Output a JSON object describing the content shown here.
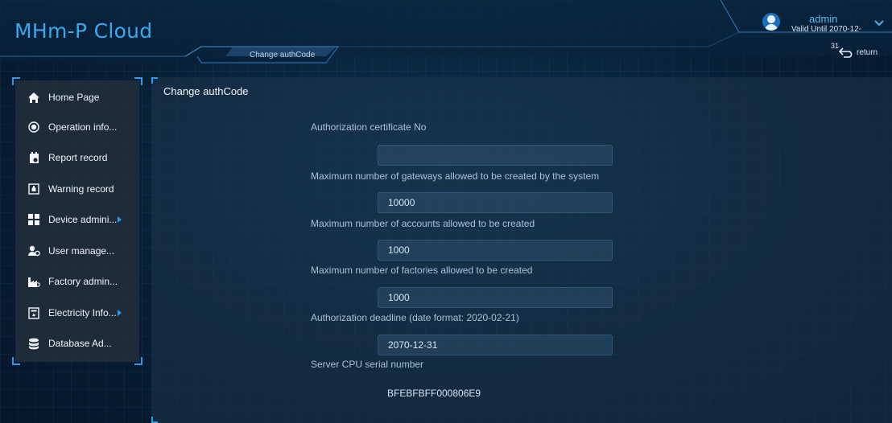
{
  "app": {
    "title": "MHm-P Cloud",
    "page_tab": "Change authCode"
  },
  "user": {
    "name": "admin",
    "valid_until": "Valid Until 2070-12-",
    "date_overflow": "31"
  },
  "header": {
    "return_label": "return"
  },
  "sidebar": {
    "items": [
      {
        "label": "Home Page",
        "icon": "home-icon",
        "has_submenu": false
      },
      {
        "label": "Operation info...",
        "icon": "target-icon",
        "has_submenu": false
      },
      {
        "label": "Report record",
        "icon": "calendar-report-icon",
        "has_submenu": false
      },
      {
        "label": "Warning record",
        "icon": "bell-icon",
        "has_submenu": false
      },
      {
        "label": "Device admini...",
        "icon": "grid-icon",
        "has_submenu": true
      },
      {
        "label": "User manage...",
        "icon": "user-gear-icon",
        "has_submenu": false
      },
      {
        "label": "Factory admin...",
        "icon": "factory-icon",
        "has_submenu": false
      },
      {
        "label": "Electricity Info...",
        "icon": "meter-icon",
        "has_submenu": true
      },
      {
        "label": "Database Ad...",
        "icon": "database-icon",
        "has_submenu": false
      }
    ]
  },
  "main": {
    "title": "Change authCode",
    "fields": [
      {
        "label": "Authorization certificate No",
        "value": ""
      },
      {
        "label": "Maximum number of gateways allowed to be created by the system",
        "value": "10000"
      },
      {
        "label": "Maximum number of accounts allowed to be created",
        "value": "1000"
      },
      {
        "label": "Maximum number of factories allowed to be created",
        "value": "1000"
      },
      {
        "label": "Authorization deadline (date format: 2020-02-21)",
        "value": "2070-12-31"
      },
      {
        "label": "Server CPU serial number",
        "value": "BFEBFBFF000806E9"
      }
    ]
  },
  "colors": {
    "accent": "#2f9be8",
    "title": "#37a9f0",
    "background": "#071a2d"
  }
}
